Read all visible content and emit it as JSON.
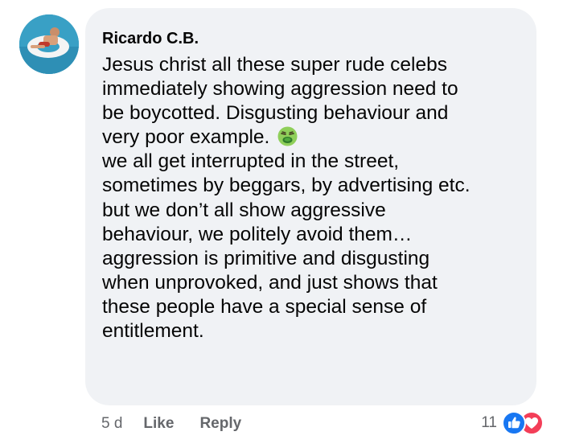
{
  "comment": {
    "author": "Ricardo C.B.",
    "lines": [
      "Jesus christ all these super rude celebs",
      "immediately showing aggression need to",
      "be boycotted. Disgusting behaviour and",
      "very poor example.",
      "we all get interrupted in the street,",
      "sometimes by beggars, by advertising etc.",
      "but we don’t all show aggressive",
      "behaviour, we politely avoid them…",
      "aggression is primitive and disgusting",
      "when unprovoked, and just shows that",
      "these people have a special sense of",
      "entitlement."
    ],
    "inline_emoji": "nauseated-face-icon"
  },
  "actions": {
    "time": "5 d",
    "like_label": "Like",
    "reply_label": "Reply"
  },
  "reactions": {
    "count": "11",
    "icons": [
      "like-reaction-icon",
      "love-reaction-icon"
    ]
  },
  "colors": {
    "bubble_bg": "#f0f2f5",
    "text": "#050505",
    "meta_text": "#65676b",
    "like_blue": "#1877f2",
    "love_red": "#f33e58"
  }
}
